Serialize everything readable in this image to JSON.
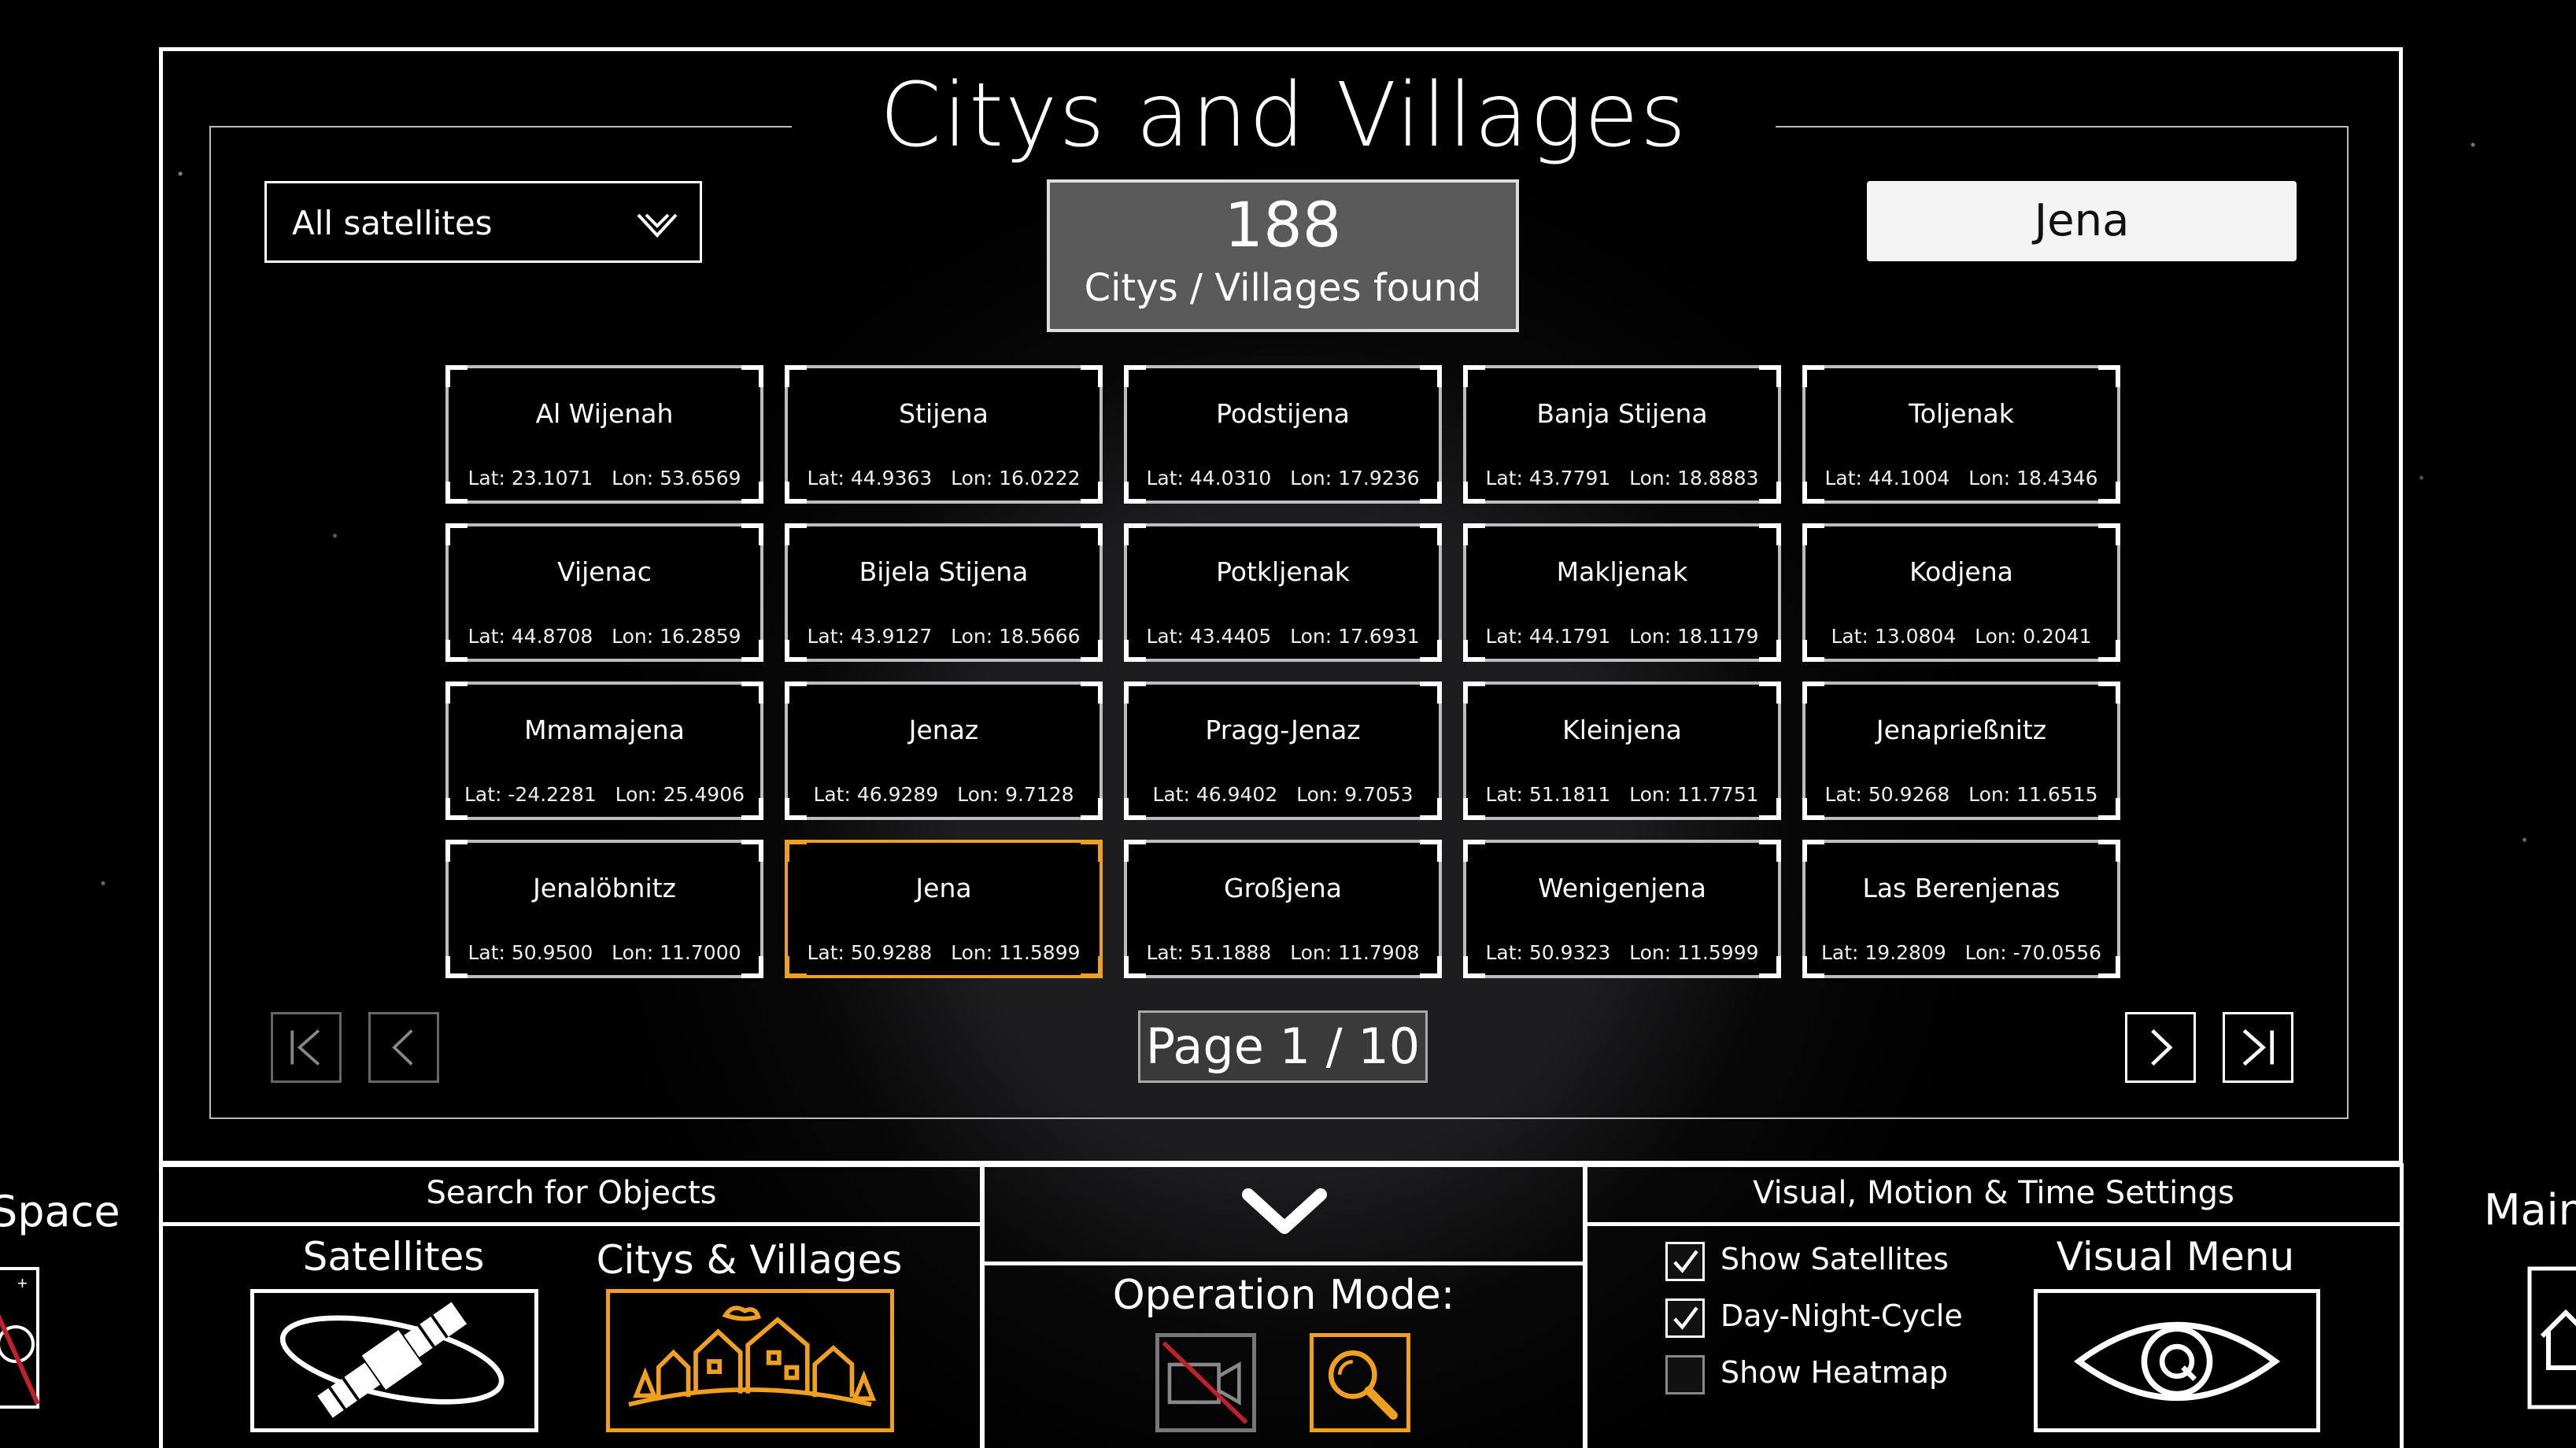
{
  "panel": {
    "title": "Citys and Villages",
    "filter": {
      "selected": "All satellites"
    },
    "counter": {
      "count": "188",
      "label": "Citys / Villages found"
    },
    "search": {
      "value": "Jena"
    },
    "results": [
      {
        "name": "Al Wijenah",
        "coords": "Lat: 23.1071   Lon: 53.6569"
      },
      {
        "name": "Stijena",
        "coords": "Lat: 44.9363   Lon: 16.0222"
      },
      {
        "name": "Podstijena",
        "coords": "Lat: 44.0310   Lon: 17.9236"
      },
      {
        "name": "Banja Stijena",
        "coords": "Lat: 43.7791   Lon: 18.8883"
      },
      {
        "name": "Toljenak",
        "coords": "Lat: 44.1004   Lon: 18.4346"
      },
      {
        "name": "Vijenac",
        "coords": "Lat: 44.8708   Lon: 16.2859"
      },
      {
        "name": "Bijela Stijena",
        "coords": "Lat: 43.9127   Lon: 18.5666"
      },
      {
        "name": "Potkljenak",
        "coords": "Lat: 43.4405   Lon: 17.6931"
      },
      {
        "name": "Makljenak",
        "coords": "Lat: 44.1791   Lon: 18.1179"
      },
      {
        "name": "Kodjena",
        "coords": "Lat: 13.0804   Lon: 0.2041"
      },
      {
        "name": "Mmamajena",
        "coords": "Lat: -24.2281   Lon: 25.4906"
      },
      {
        "name": "Jenaz",
        "coords": "Lat: 46.9289   Lon: 9.7128"
      },
      {
        "name": "Pragg-Jenaz",
        "coords": "Lat: 46.9402   Lon: 9.7053"
      },
      {
        "name": "Kleinjena",
        "coords": "Lat: 51.1811   Lon: 11.7751"
      },
      {
        "name": "Jenaprießnitz",
        "coords": "Lat: 50.9268   Lon: 11.6515"
      },
      {
        "name": "Jenalöbnitz",
        "coords": "Lat: 50.9500   Lon: 11.7000"
      },
      {
        "name": "Jena",
        "coords": "Lat: 50.9288   Lon: 11.5899",
        "selected": true
      },
      {
        "name": "Großjena",
        "coords": "Lat: 51.1888   Lon: 11.7908"
      },
      {
        "name": "Wenigenjena",
        "coords": "Lat: 50.9323   Lon: 11.5999"
      },
      {
        "name": "Las Berenjenas",
        "coords": "Lat: 19.2809   Lon: -70.0556"
      }
    ],
    "pagination": {
      "label": "Page 1 / 10",
      "current": 1,
      "total": 10
    }
  },
  "bottom": {
    "left_edge_label": "Space",
    "search_section": {
      "title": "Search for Objects",
      "satellites_label": "Satellites",
      "citys_label": "Citys & Villages"
    },
    "operation": {
      "label": "Operation Mode:"
    },
    "settings": {
      "title": "Visual, Motion & Time Settings",
      "options": [
        {
          "label": "Show Satellites",
          "checked": true
        },
        {
          "label": "Day-Night-Cycle",
          "checked": true
        },
        {
          "label": "Show Heatmap",
          "checked": false
        }
      ],
      "visual_menu_label": "Visual Menu"
    },
    "right_edge_label": "Main"
  },
  "colors": {
    "accent": "#f0a020",
    "background": "#000000",
    "text": "#ffffff"
  },
  "icons": [
    "chevron-down-icon",
    "first-page-icon",
    "prev-page-icon",
    "next-page-icon",
    "last-page-icon",
    "satellite-icon",
    "village-icon",
    "camera-off-icon",
    "magnifier-icon",
    "eye-icon",
    "home-icon",
    "checkmark-icon"
  ]
}
